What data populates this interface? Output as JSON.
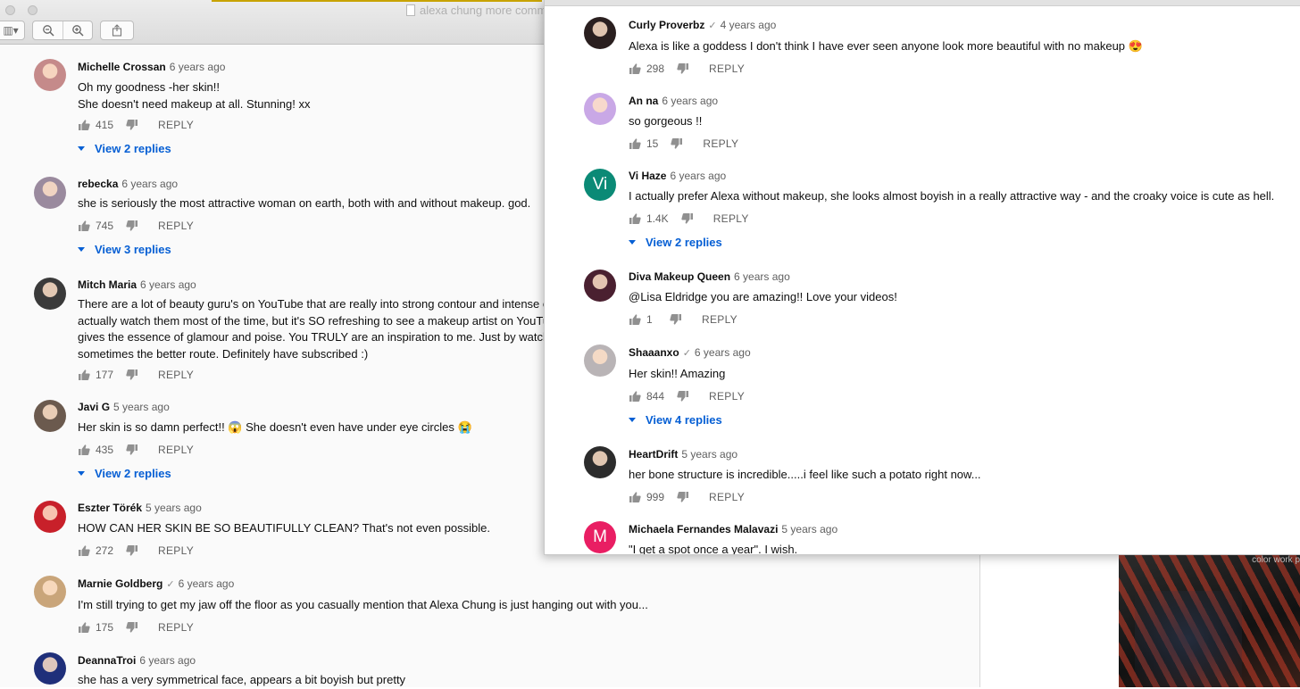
{
  "left_window": {
    "title": "alexa chung more comme",
    "toolbar_icons": [
      "sidebar-icon",
      "zoom-out-icon",
      "zoom-in-icon",
      "share-icon"
    ]
  },
  "left_comments": [
    {
      "author": "Michelle Crossan",
      "verified": false,
      "time": "6 years ago",
      "lines": [
        "Oh my goodness -her skin!!",
        "She doesn't need makeup at all. Stunning! xx"
      ],
      "likes": "415",
      "reply": "REPLY",
      "view_replies": "View 2 replies",
      "avatar_color": "#c58a8a"
    },
    {
      "author": "rebecka",
      "verified": false,
      "time": "6 years ago",
      "lines": [
        "she is seriously the most attractive woman on earth, both with and without makeup. god."
      ],
      "likes": "745",
      "reply": "REPLY",
      "view_replies": "View 3 replies",
      "avatar_color": "#9a8a9e"
    },
    {
      "author": "Mitch Maria",
      "verified": false,
      "time": "6 years ago",
      "lines": [
        "There are a lot of beauty guru's on YouTube that are really into strong contour and intense eye",
        "actually watch them most of the time, but it's SO refreshing to see a makeup artist on YouTube",
        "gives the essence of glamour and poise. You TRULY are an inspiration to me. Just by watching",
        "sometimes the better route. Definitely have subscribed :)"
      ],
      "likes": "177",
      "reply": "REPLY",
      "view_replies": "",
      "avatar_color": "#3a3a3a"
    },
    {
      "author": "Javi G",
      "verified": false,
      "time": "5 years ago",
      "lines": [
        "Her skin is so damn perfect!! 😱 She doesn't even have under eye circles 😭"
      ],
      "likes": "435",
      "reply": "REPLY",
      "view_replies": "View 2 replies",
      "avatar_color": "#6b5a4e"
    },
    {
      "author": "Eszter Törék",
      "verified": false,
      "time": "5 years ago",
      "lines": [
        "HOW CAN HER SKIN BE SO BEAUTIFULLY CLEAN? That's not even possible."
      ],
      "likes": "272",
      "reply": "REPLY",
      "view_replies": "",
      "avatar_color": "#c8202a"
    },
    {
      "author": "Marnie Goldberg",
      "verified": true,
      "time": "6 years ago",
      "lines": [
        "I'm still trying to get my jaw off the floor as you casually mention that Alexa Chung is just hanging out with you..."
      ],
      "likes": "175",
      "reply": "REPLY",
      "view_replies": "",
      "avatar_color": "#c9a57a"
    },
    {
      "author": "DeannaTroi",
      "verified": false,
      "time": "6 years ago",
      "lines": [
        "she has a very symmetrical face, appears a bit boyish but pretty"
      ],
      "likes": "",
      "reply": "",
      "view_replies": "",
      "avatar_color": "#1f2f7a"
    }
  ],
  "right_comments": [
    {
      "author": "Curly Proverbz",
      "verified": true,
      "time": "4 years ago",
      "lines": [
        "Alexa is like a goddess I don't think I have ever seen anyone look more beautiful with no makeup 😍"
      ],
      "likes": "298",
      "reply": "REPLY",
      "view_replies": "",
      "avatar_color": "#2a1f1f",
      "avatar_letter": ""
    },
    {
      "author": "An na",
      "verified": false,
      "time": "6 years ago",
      "lines": [
        "so gorgeous !!"
      ],
      "likes": "15",
      "reply": "REPLY",
      "view_replies": "",
      "avatar_color": "#c9a8e6",
      "avatar_letter": ""
    },
    {
      "author": "Vi Haze",
      "verified": false,
      "time": "6 years ago",
      "lines": [
        "I actually prefer Alexa without makeup, she looks almost boyish in a really attractive way - and the croaky voice is cute as hell."
      ],
      "likes": "1.4K",
      "reply": "REPLY",
      "view_replies": "View 2 replies",
      "avatar_color": "#0b8a76",
      "avatar_letter": "Vi"
    },
    {
      "author": "Diva Makeup Queen",
      "verified": false,
      "time": "6 years ago",
      "lines": [
        " @Lisa Eldridge  you are amazing!! Love your videos!"
      ],
      "likes": "1",
      "reply": "REPLY",
      "view_replies": "",
      "avatar_color": "#4a2030",
      "avatar_letter": ""
    },
    {
      "author": "Shaaanxo",
      "verified": true,
      "time": "6 years ago",
      "lines": [
        "Her skin!! Amazing"
      ],
      "likes": "844",
      "reply": "REPLY",
      "view_replies": "View 4 replies",
      "avatar_color": "#b9b4b6",
      "avatar_letter": ""
    },
    {
      "author": "HeartDrift",
      "verified": false,
      "time": "5 years ago",
      "lines": [
        "her bone structure is incredible.....i feel like such a potato right now..."
      ],
      "likes": "999",
      "reply": "REPLY",
      "view_replies": "",
      "avatar_color": "#2c2c2c",
      "avatar_letter": ""
    },
    {
      "author": "Michaela Fernandes Malavazi",
      "verified": false,
      "time": "5 years ago",
      "lines": [
        "\"I get a spot once a year\". I wish."
      ],
      "likes": "",
      "reply": "",
      "view_replies": "",
      "avatar_color": "#e91e63",
      "avatar_letter": "M"
    }
  ],
  "dark_panel": {
    "caption": "color work p"
  }
}
